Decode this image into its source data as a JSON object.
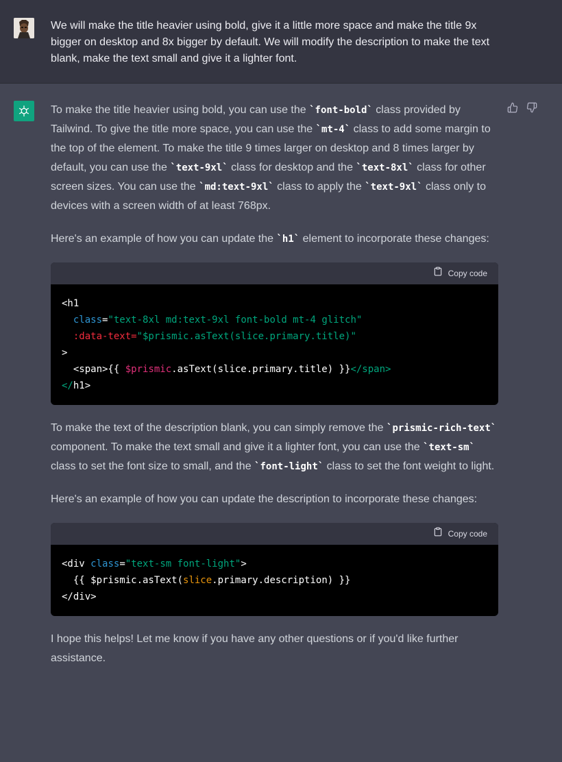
{
  "user_message": {
    "text": "We will make the title heavier using bold, give it a little more space and make the title 9x bigger on desktop and 8x bigger by default. We will modify the description to make the text blank, make the text small and give it a lighter font."
  },
  "assistant": {
    "p1": {
      "s1": "To make the title heavier using bold, you can use the ",
      "c1": "`font-bold`",
      "s2": " class provided by Tailwind. To give the title more space, you can use the ",
      "c2": "`mt-4`",
      "s3": " class to add some margin to the top of the element. To make the title 9 times larger on desktop and 8 times larger by default, you can use the ",
      "c3": "`text-9xl`",
      "s4": " class for desktop and the ",
      "c4": "`text-8xl`",
      "s5": " class for other screen sizes. You can use the ",
      "c5": "`md:text-9xl`",
      "s6": " class to apply the ",
      "c6": "`text-9xl`",
      "s7": " class only to devices with a screen width of at least 768px."
    },
    "p2": {
      "s1": "Here's an example of how you can update the ",
      "c1": "`h1`",
      "s2": " element to incorporate these changes:"
    },
    "code1": {
      "copy_label": "Copy code",
      "l1": "<h1",
      "l2_attr": "class",
      "l2_eq": "=",
      "l2_val": "\"text-8xl md:text-9xl font-bold mt-4 glitch\"",
      "l3_attr": ":data-text=",
      "l3_val": "\"$prismic.asText(slice.primary.title)\"",
      "l4": ">",
      "l5_a": "<span>{{ ",
      "l5_var": "$prismic",
      "l5_b": ".asText(slice.primary.title) }}",
      "l5_close": "</span>",
      "l6_a": "</",
      "l6_b": "h1>"
    },
    "p3": {
      "s1": "To make the text of the description blank, you can simply remove the ",
      "c1": "`prismic-rich-text`",
      "s2": " component. To make the text small and give it a lighter font, you can use the ",
      "c2": "`text-sm`",
      "s3": " class to set the font size to small, and the ",
      "c3": "`font-light`",
      "s4": " class to set the font weight to light."
    },
    "p4": {
      "s1": "Here's an example of how you can update the description to incorporate these changes:"
    },
    "code2": {
      "copy_label": "Copy code",
      "l1_a": "<div ",
      "l1_attr": "class",
      "l1_eq": "=",
      "l1_val": "\"text-sm font-light\"",
      "l1_b": ">",
      "l2_a": "{{ $prismic.asText(",
      "l2_var": "slice",
      "l2_b": ".primary.description) }}",
      "l3": "</div>"
    },
    "p5": {
      "s1": "I hope this helps! Let me know if you have any other questions or if you'd like further assistance."
    }
  },
  "colors": {
    "user_bg": "#343541",
    "assistant_bg": "#444654",
    "gpt_green": "#10a37f",
    "code_bg": "#000000"
  },
  "icons": [
    "user-avatar",
    "openai-logo-icon",
    "thumbs-up-icon",
    "thumbs-down-icon",
    "clipboard-icon"
  ]
}
